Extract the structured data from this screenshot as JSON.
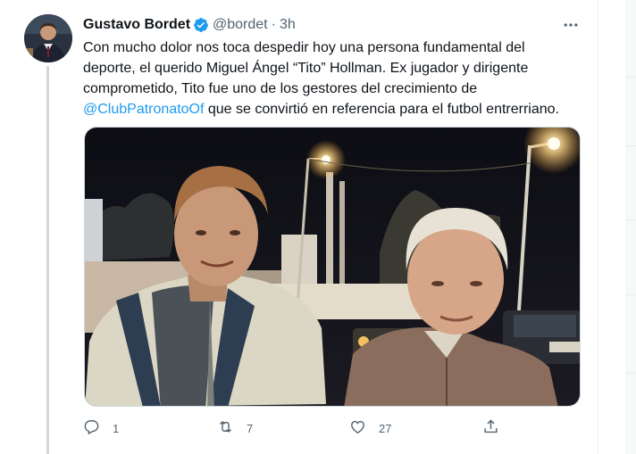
{
  "tweet": {
    "author_name": "Gustavo Bordet",
    "handle": "@bordet",
    "separator": "·",
    "time": "3h",
    "text_lines": [
      "Con mucho dolor nos toca despedir hoy una persona fundamental del",
      "deporte, el querido Miguel Ángel “Tito” Hollman. Ex jugador y dirigente",
      "comprometido, Tito fue uno de los gestores del crecimiento de"
    ],
    "mention": "@ClubPatronatoOf",
    "text_tail": " que se convirtió en referencia para el futbol entrerriano."
  },
  "actions": {
    "reply_count": "1",
    "retweet_count": "7",
    "like_count": "27"
  },
  "icons": {
    "more": "more-horizontal-icon",
    "verified": "verified-badge-icon",
    "reply": "reply-icon",
    "retweet": "retweet-icon",
    "like": "heart-icon",
    "share": "share-icon"
  },
  "colors": {
    "accent": "#1d9bf0",
    "secondary_text": "#536471",
    "primary_text": "#0f1419",
    "thread_line": "#cfd9de"
  }
}
